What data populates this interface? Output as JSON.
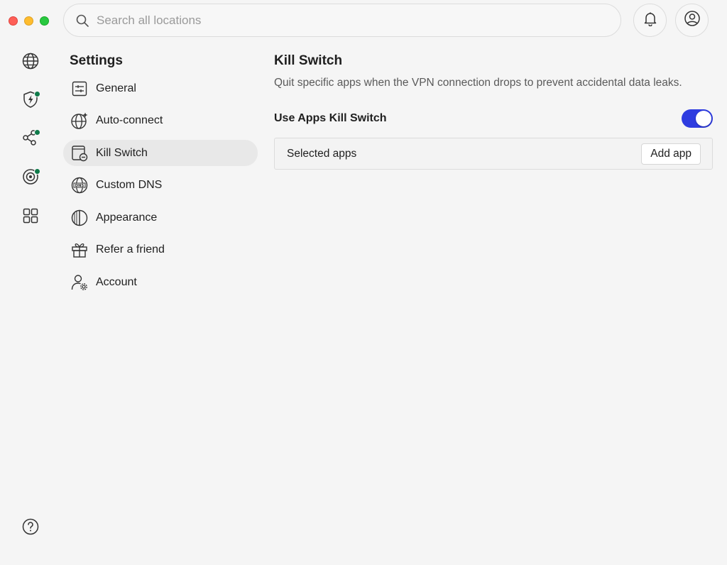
{
  "search": {
    "placeholder": "Search all locations"
  },
  "header": {
    "notifications_icon": "bell-icon",
    "account_icon": "user-circle-icon"
  },
  "rail": {
    "items": [
      {
        "icon": "globe-icon"
      },
      {
        "icon": "shield-bolt-icon",
        "badge": true
      },
      {
        "icon": "meshnet-icon",
        "badge": true
      },
      {
        "icon": "dark-web-monitor-icon",
        "badge": true
      },
      {
        "icon": "apps-grid-icon"
      }
    ],
    "help_icon": "help-icon"
  },
  "sidebar": {
    "title": "Settings",
    "items": [
      {
        "label": "General",
        "icon": "sliders-icon",
        "active": false
      },
      {
        "label": "Auto-connect",
        "icon": "globe-sparkle-icon",
        "active": false
      },
      {
        "label": "Kill Switch",
        "icon": "kill-switch-icon",
        "active": true
      },
      {
        "label": "Custom DNS",
        "icon": "dns-globe-icon",
        "active": false
      },
      {
        "label": "Appearance",
        "icon": "appearance-icon",
        "active": false
      },
      {
        "label": "Refer a friend",
        "icon": "gift-icon",
        "active": false
      },
      {
        "label": "Account",
        "icon": "account-gear-icon",
        "active": false
      }
    ]
  },
  "main": {
    "title": "Kill Switch",
    "description": "Quit specific apps when the VPN connection drops to prevent accidental data leaks.",
    "toggle_label": "Use Apps Kill Switch",
    "toggle_on": true,
    "selected_apps_label": "Selected apps",
    "add_app_label": "Add app"
  },
  "colors": {
    "accent": "#2e3ce0",
    "badge": "#0f7a4a",
    "background": "#f5f5f5"
  }
}
